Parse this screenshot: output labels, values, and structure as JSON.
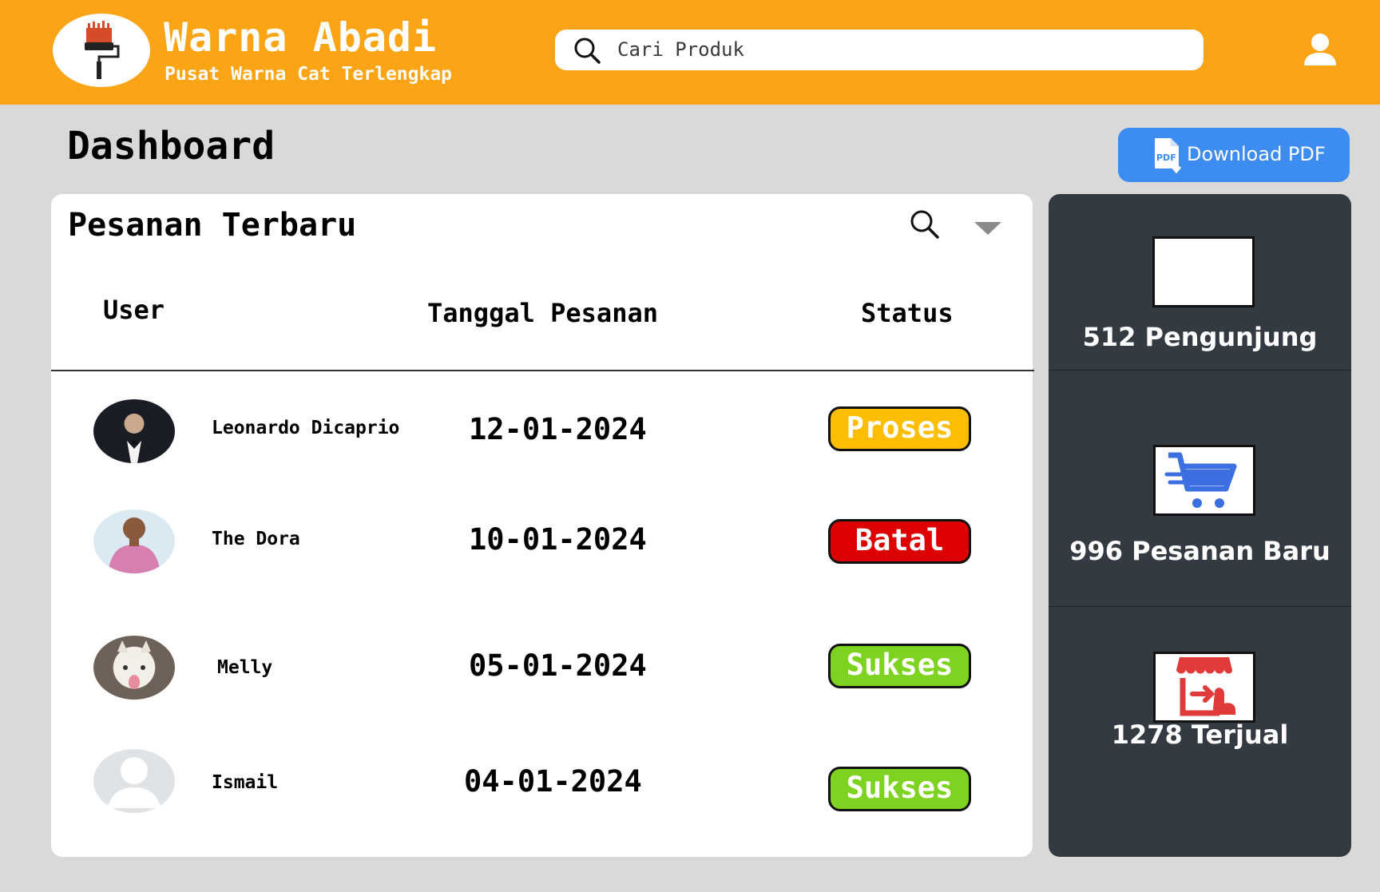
{
  "header": {
    "brand_title": "Warna Abadi",
    "brand_subtitle": "Pusat Warna Cat Terlengkap",
    "search_placeholder": "Cari Produk",
    "logo_icon": "paint-roller-icon",
    "search_icon": "search-icon",
    "profile_icon": "user-icon"
  },
  "page": {
    "title": "Dashboard",
    "download_label": "Download PDF",
    "download_icon": "pdf-download-icon"
  },
  "orders": {
    "title": "Pesanan Terbaru",
    "columns": {
      "user": "User",
      "date": "Tanggal Pesanan",
      "status": "Status"
    },
    "rows": [
      {
        "name": "Leonardo Dicaprio",
        "date": "12-01-2024",
        "status": "Proses",
        "status_color": "#fdbd01",
        "status_text_color": "#ffffff"
      },
      {
        "name": "The Dora",
        "date": "10-01-2024",
        "status": "Batal",
        "status_color": "#dd0000",
        "status_text_color": "#ffffff"
      },
      {
        "name": "Melly",
        "date": "05-01-2024",
        "status": "Sukses",
        "status_color": "#7ed321",
        "status_text_color": "#ffffff"
      },
      {
        "name": "Ismail",
        "date": "04-01-2024",
        "status": "Sukses",
        "status_color": "#7ed321",
        "status_text_color": "#ffffff"
      }
    ]
  },
  "stats": [
    {
      "label": "512 Pengunjung",
      "icon": "blank-image-icon"
    },
    {
      "label": "996 Pesanan Baru",
      "icon": "shopping-cart-icon"
    },
    {
      "label": "1278 Terjual",
      "icon": "store-sales-icon"
    }
  ],
  "colors": {
    "header_bg": "#fba516",
    "page_bg": "#d9d9d9",
    "stats_bg": "#343a41",
    "download_btn": "#3c8cf2"
  }
}
